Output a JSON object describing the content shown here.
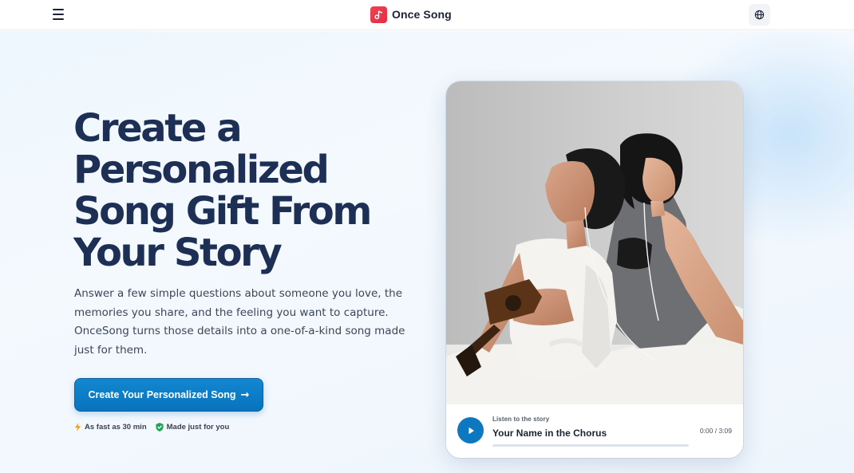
{
  "header": {
    "brand_name": "Once Song",
    "menu_icon": "hamburger-icon",
    "language_icon": "globe-icon",
    "logo_color": "#e8344a"
  },
  "hero": {
    "headline": "Create a Personalized Song Gift From Your Story",
    "subtitle": "Answer a few simple questions about someone you love, the memories you share, and the feeling you want to capture. OnceSong turns those details into a one-of-a-kind song made just for them.",
    "cta_label": "Create Your Personalized Song",
    "cta_arrow": "→",
    "badges": [
      {
        "icon": "lightning-icon",
        "label": "As fast as 30 min"
      },
      {
        "icon": "shield-check-icon",
        "label": "Made just for you"
      }
    ],
    "accent_color": "#0d77c0",
    "headline_color": "#1d2f55"
  },
  "player": {
    "kicker": "Listen to the story",
    "title": "Your Name in the Chorus",
    "time": "0:00 / 3:09",
    "progress": 0,
    "play_icon": "play-icon"
  }
}
